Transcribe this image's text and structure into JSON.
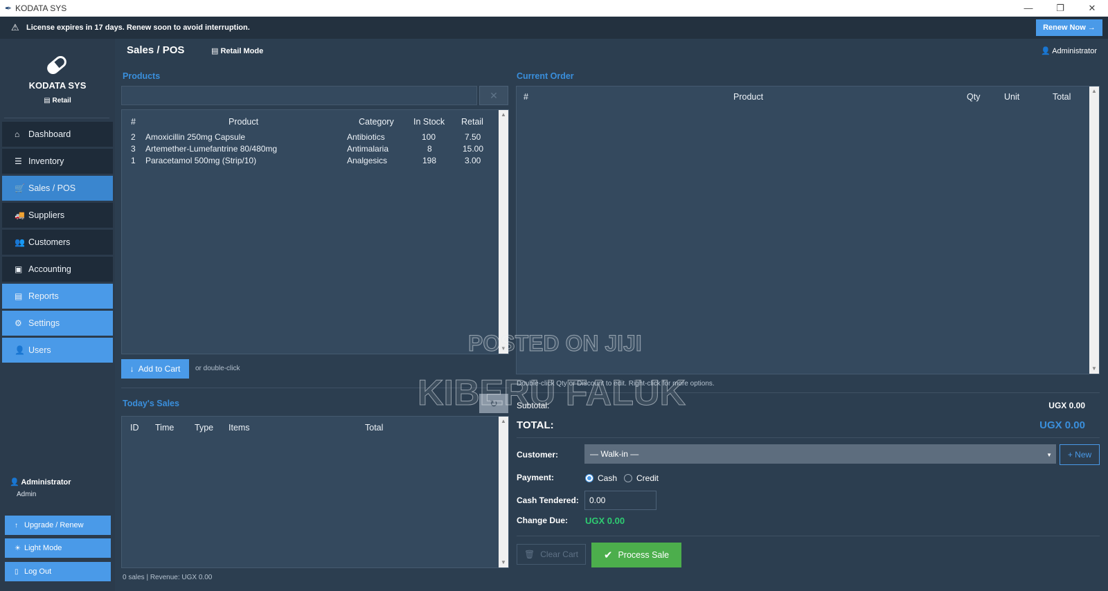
{
  "window": {
    "title": "KODATA SYS",
    "controls": [
      "—",
      "❐",
      "✕"
    ]
  },
  "license": {
    "message": "License expires in 17 days.  Renew soon to avoid interruption.",
    "renew_label": "Renew Now →"
  },
  "sidebar": {
    "brand": "KODATA SYS",
    "mode": "Retail",
    "items": [
      {
        "label": "Dashboard",
        "icon": "home-icon",
        "glyph": "⌂"
      },
      {
        "label": "Inventory",
        "icon": "list-icon",
        "glyph": "☰"
      },
      {
        "label": "Sales / POS",
        "icon": "cart-icon",
        "glyph": "🛒"
      },
      {
        "label": "Suppliers",
        "icon": "truck-icon",
        "glyph": "🚚"
      },
      {
        "label": "Customers",
        "icon": "users-icon",
        "glyph": "👥"
      },
      {
        "label": "Accounting",
        "icon": "book-icon",
        "glyph": "▣"
      },
      {
        "label": "Reports",
        "icon": "chart-icon",
        "glyph": "▤"
      },
      {
        "label": "Settings",
        "icon": "gear-icon",
        "glyph": "⚙"
      },
      {
        "label": "Users",
        "icon": "user-icon",
        "glyph": "👤"
      }
    ],
    "user_name": "Administrator",
    "user_role": "Admin",
    "upgrade_label": "Upgrade / Renew",
    "light_mode_label": "Light Mode",
    "logout_label": "Log Out"
  },
  "header": {
    "title": "Sales / POS",
    "mode_label": "Retail Mode",
    "user": "Administrator"
  },
  "products": {
    "section_title": "Products",
    "search_value": "",
    "columns": [
      "#",
      "Product",
      "Category",
      "In Stock",
      "Retail"
    ],
    "rows": [
      {
        "id": "2",
        "product": "Amoxicillin 250mg Capsule",
        "category": "Antibiotics",
        "stock": "100",
        "retail": "7.50"
      },
      {
        "id": "3",
        "product": "Artemether-Lumefantrine 80/480mg",
        "category": "Antimalaria",
        "stock": "8",
        "retail": "15.00"
      },
      {
        "id": "1",
        "product": "Paracetamol 500mg (Strip/10)",
        "category": "Analgesics",
        "stock": "198",
        "retail": "3.00"
      }
    ],
    "add_to_cart_label": "Add to Cart",
    "add_hint": "or double-click"
  },
  "todays_sales": {
    "section_title": "Today's Sales",
    "columns": [
      "ID",
      "Time",
      "Type",
      "Items",
      "Total"
    ],
    "status": "0 sales  |  Revenue: UGX 0.00"
  },
  "order": {
    "section_title": "Current Order",
    "columns": [
      "#",
      "Product",
      "Qty",
      "Unit",
      "Total"
    ],
    "hint": "Double-click Qty or Discount to edit. Right-click for more options.",
    "subtotal_label": "Subtotal:",
    "subtotal_value": "UGX 0.00",
    "total_label": "TOTAL:",
    "total_value": "UGX 0.00",
    "customer_label": "Customer:",
    "customer_value": "— Walk-in —",
    "new_customer_label": "+ New",
    "payment_label": "Payment:",
    "payment_options": [
      "Cash",
      "Credit"
    ],
    "cash_tendered_label": "Cash Tendered:",
    "cash_tendered_value": "0.00",
    "change_due_label": "Change Due:",
    "change_due_value": "UGX 0.00",
    "clear_cart_label": "Clear Cart",
    "process_sale_label": "Process Sale"
  },
  "watermark": {
    "line1": "POSTED ON JIJI",
    "line2": "KIBERU FALUK"
  },
  "colors": {
    "accent": "#4a9ae8",
    "success": "#4cae4c",
    "background": "#2c3e50",
    "panel": "#34495e"
  }
}
